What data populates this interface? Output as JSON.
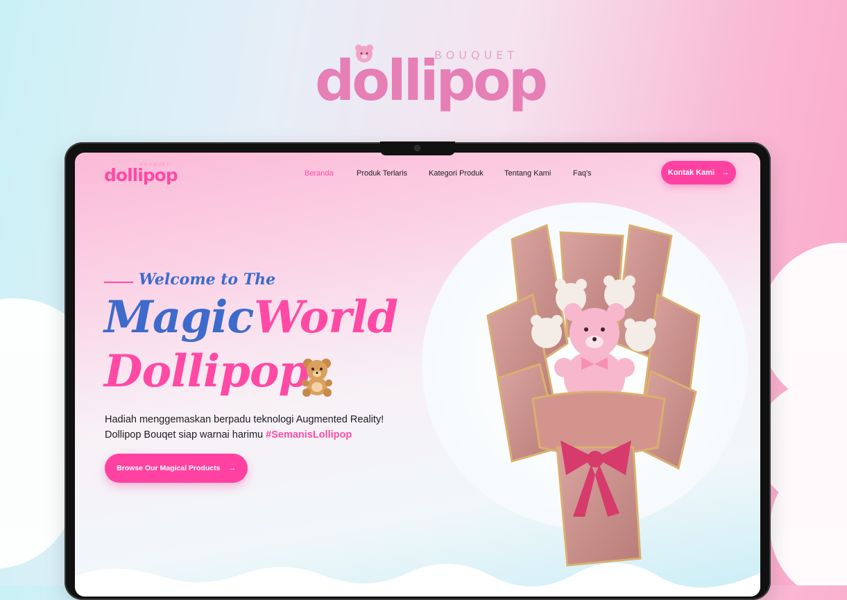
{
  "brand": {
    "name": "dollipop",
    "sub": "BOUQUET"
  },
  "nav": {
    "logo": "dollipop",
    "logo_sub": "BOUQUET",
    "items": [
      {
        "label": "Beranda",
        "active": true
      },
      {
        "label": "Produk Terlaris",
        "active": false
      },
      {
        "label": "Kategori Produk",
        "active": false
      },
      {
        "label": "Tentang Kami",
        "active": false
      },
      {
        "label": "Faq's",
        "active": false
      }
    ],
    "contact_label": "Kontak Kami"
  },
  "hero": {
    "welcome": "Welcome to The",
    "title_part1": "Magic",
    "title_part2": "World",
    "title_line2": "Dollipop",
    "desc_line1": "Hadiah menggemaskan berpadu teknologi Augmented Reality!",
    "desc_line2": "Dollipop Bouqet siap warnai harimu",
    "hashtag": "#SemanisLollipop",
    "cta_label": "Browse Our Magical Products"
  },
  "icons": {
    "arrow": "arrow-right-icon",
    "bear": "teddy-bear-icon",
    "camera": "camera-icon"
  },
  "colors": {
    "accent_pink": "#ff42a1",
    "accent_blue": "#3e6bcb"
  }
}
